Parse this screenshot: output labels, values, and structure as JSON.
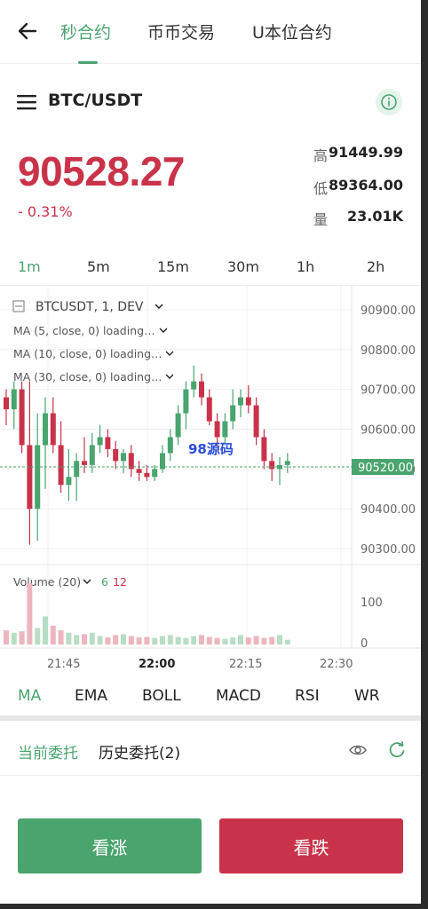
{
  "nav": {
    "tabs": [
      "秒合约",
      "币币交易",
      "U本位合约"
    ],
    "active_tab": 0
  },
  "pair": {
    "symbol": "BTC/USDT"
  },
  "ticker": {
    "price": "90528.27",
    "change": "- 0.31%",
    "high_label": "高",
    "high": "91449.99",
    "low_label": "低",
    "low": "89364.00",
    "vol_label": "量",
    "volume": "23.01K"
  },
  "intervals": {
    "items": [
      "1m",
      "5m",
      "15m",
      "30m",
      "1h",
      "2h"
    ],
    "active": 0
  },
  "chart": {
    "legend_symbol": "BTCUSDT, 1, DEV",
    "ma_lines": [
      "MA (5, close, 0) loading…",
      "MA (10, close, 0) loading…",
      "MA (30, close, 0) loading…"
    ],
    "price_axis": [
      "90900.00",
      "90800.00",
      "90700.00",
      "90600.00",
      "90500.00",
      "90400.00",
      "90300.00"
    ],
    "last_price": "90520.00",
    "watermark": "98源码",
    "volume_label": "Volume (20)",
    "volume_up": "6",
    "volume_down": "12",
    "volume_axis": [
      "100",
      "0"
    ],
    "time_axis": [
      "21:45",
      "22:00",
      "22:15",
      "22:30"
    ],
    "up_color": "#4aa46e",
    "down_color": "#c9334a"
  },
  "chart_data": {
    "type": "candlestick",
    "ylim": [
      90260,
      90960
    ],
    "candles": [
      [
        90680,
        90700,
        90610,
        90650
      ],
      [
        90650,
        90720,
        90600,
        90700
      ],
      [
        90700,
        90720,
        90540,
        90560
      ],
      [
        90560,
        90720,
        90310,
        90400
      ],
      [
        90400,
        90640,
        90320,
        90560
      ],
      [
        90560,
        90680,
        90450,
        90640
      ],
      [
        90640,
        90680,
        90540,
        90560
      ],
      [
        90560,
        90620,
        90440,
        90460
      ],
      [
        90460,
        90550,
        90420,
        90480
      ],
      [
        90480,
        90540,
        90420,
        90520
      ],
      [
        90520,
        90580,
        90490,
        90510
      ],
      [
        90510,
        90590,
        90490,
        90560
      ],
      [
        90560,
        90610,
        90540,
        90580
      ],
      [
        90580,
        90600,
        90530,
        90550
      ],
      [
        90550,
        90570,
        90500,
        90520
      ],
      [
        90520,
        90550,
        90490,
        90540
      ],
      [
        90540,
        90560,
        90480,
        90500
      ],
      [
        90500,
        90520,
        90470,
        90490
      ],
      [
        90490,
        90510,
        90470,
        90480
      ],
      [
        90480,
        90510,
        90470,
        90500
      ],
      [
        90500,
        90560,
        90490,
        90540
      ],
      [
        90540,
        90600,
        90520,
        90580
      ],
      [
        90580,
        90660,
        90560,
        90640
      ],
      [
        90640,
        90720,
        90600,
        90700
      ],
      [
        90700,
        90760,
        90680,
        90720
      ],
      [
        90720,
        90740,
        90660,
        90680
      ],
      [
        90680,
        90700,
        90610,
        90620
      ],
      [
        90620,
        90640,
        90560,
        90580
      ],
      [
        90580,
        90640,
        90560,
        90620
      ],
      [
        90620,
        90700,
        90600,
        90660
      ],
      [
        90660,
        90700,
        90630,
        90680
      ],
      [
        90680,
        90710,
        90640,
        90660
      ],
      [
        90660,
        90680,
        90560,
        90580
      ],
      [
        90580,
        90600,
        90500,
        90520
      ],
      [
        90520,
        90540,
        90470,
        90500
      ],
      [
        90500,
        90530,
        90460,
        90510
      ],
      [
        90510,
        90540,
        90490,
        90520
      ]
    ],
    "volumes": [
      30,
      25,
      28,
      130,
      35,
      60,
      40,
      30,
      25,
      20,
      22,
      25,
      18,
      15,
      20,
      22,
      18,
      15,
      16,
      14,
      18,
      20,
      16,
      14,
      18,
      20,
      16,
      14,
      12,
      15,
      20,
      15,
      18,
      14,
      16,
      20,
      10
    ]
  },
  "indicators": {
    "items": [
      "MA",
      "EMA",
      "BOLL",
      "MACD",
      "RSI",
      "WR"
    ],
    "active": 0
  },
  "orders": {
    "current": "当前委托",
    "history": "历史委托(2)"
  },
  "actions": {
    "buy": "看涨",
    "sell": "看跌"
  }
}
